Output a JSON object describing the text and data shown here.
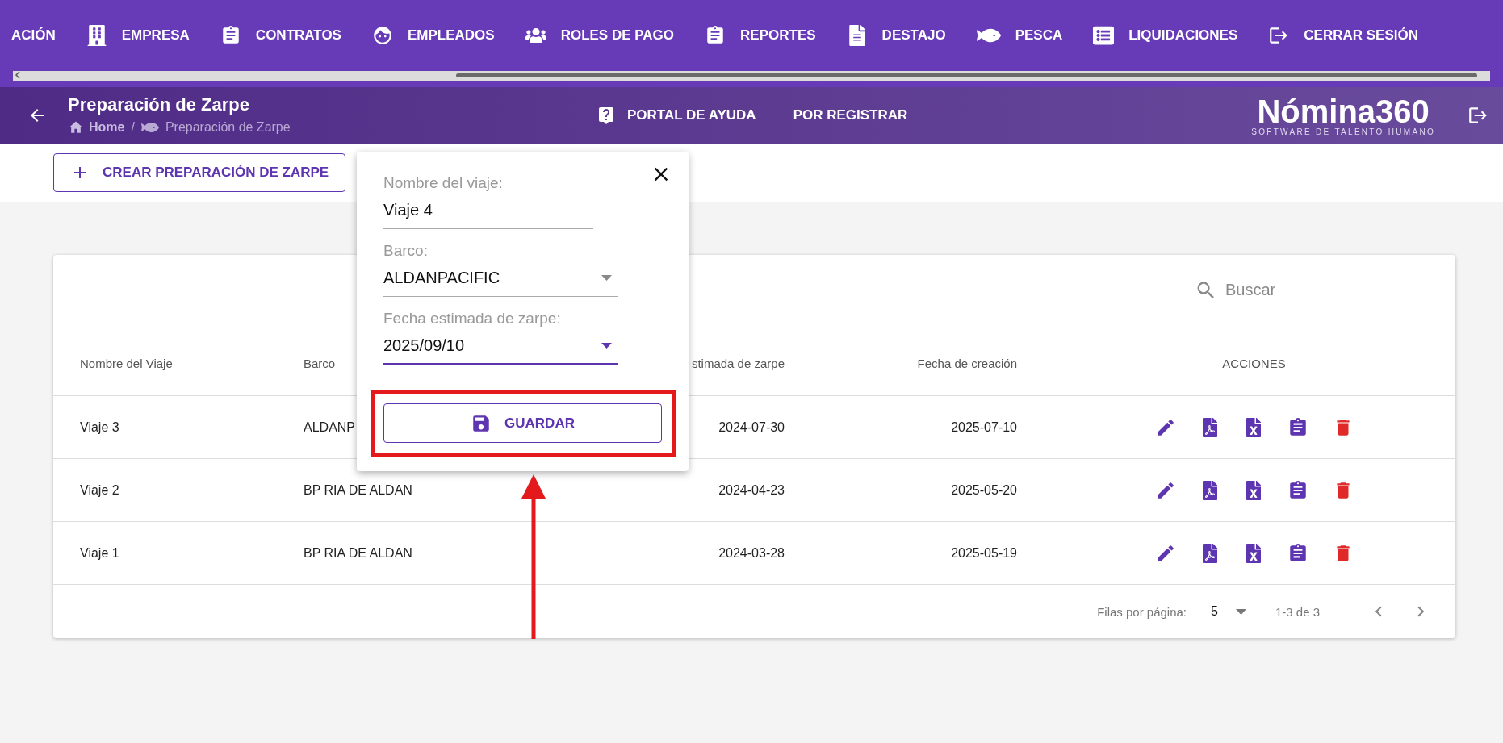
{
  "nav": {
    "items": [
      {
        "label": "ACIÓN"
      },
      {
        "label": "EMPRESA"
      },
      {
        "label": "CONTRATOS"
      },
      {
        "label": "EMPLEADOS"
      },
      {
        "label": "ROLES DE PAGO"
      },
      {
        "label": "REPORTES"
      },
      {
        "label": "DESTAJO"
      },
      {
        "label": "PESCA"
      },
      {
        "label": "LIQUIDACIONES"
      },
      {
        "label": "CERRAR SESIÓN"
      }
    ]
  },
  "header": {
    "title": "Preparación de Zarpe",
    "breadcrumb": [
      "Home",
      "/",
      "Preparación de Zarpe"
    ],
    "links": [
      "PORTAL DE AYUDA",
      "POR REGISTRAR"
    ],
    "logo": "Nómina360",
    "logo_subtitle": "SOFTWARE DE TALENTO HUMANO"
  },
  "toolbar": {
    "create_button": "CREAR PREPARACIÓN DE ZARPE"
  },
  "table": {
    "search": {
      "placeholder": "Buscar"
    },
    "columns": [
      "Nombre del Viaje",
      "Barco",
      "stimada de zarpe",
      "Fecha de creación",
      "ACCIONES"
    ],
    "rows": [
      [
        "Viaje 3",
        "ALDANP",
        "2024-07-30",
        "2025-07-10"
      ],
      [
        "Viaje 2",
        "BP RIA DE ALDAN",
        "2024-04-23",
        "2025-05-20"
      ],
      [
        "Viaje 1",
        "BP RIA DE ALDAN",
        "2024-03-28",
        "2025-05-19"
      ]
    ],
    "pagination": {
      "rows_label": "Filas por página:",
      "rows_value": "5",
      "range": "1-3 de 3"
    }
  },
  "popup": {
    "fields": [
      {
        "kind": "text",
        "label": "Nombre del viaje:",
        "value": "Viaje 4",
        "focused": false
      },
      {
        "kind": "select",
        "label": "Barco:",
        "value": "ALDANPACIFIC",
        "focused": false
      },
      {
        "kind": "select",
        "label": "Fecha estimada de zarpe:",
        "value": "2025/09/10",
        "focused": true
      }
    ],
    "button": "GUARDAR"
  }
}
